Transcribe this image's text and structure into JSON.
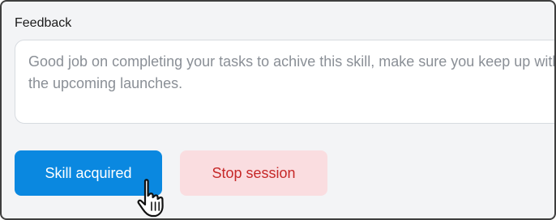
{
  "feedback": {
    "label": "Feedback",
    "text": "Good job on completing your tasks to achive this skill, make sure you keep up with the upcoming launches."
  },
  "actions": {
    "skill_acquired_label": "Skill acquired",
    "stop_session_label": "Stop session"
  },
  "colors": {
    "primary": "#0a88e0",
    "danger_bg": "#fadde0",
    "danger_text": "#c62828"
  },
  "cursor": {
    "icon": "hand-pointer-icon"
  }
}
